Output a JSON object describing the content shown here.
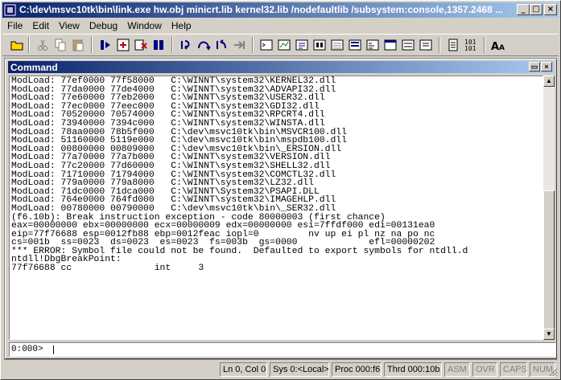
{
  "window": {
    "title": "C:\\dev\\msvc10tk\\bin\\link.exe hw.obj minicrt.lib kernel32.lib /nodefaultlib /subsystem:console,1357.2468 ..."
  },
  "menu": [
    "File",
    "Edit",
    "View",
    "Debug",
    "Window",
    "Help"
  ],
  "command_window": {
    "title": "Command",
    "output_lines": [
      "ModLoad: 77ef0000 77f58000   C:\\WINNT\\system32\\KERNEL32.dll",
      "ModLoad: 77da0000 77de4000   C:\\WINNT\\system32\\ADVAPI32.dll",
      "ModLoad: 77e60000 77eb2000   C:\\WINNT\\system32\\USER32.dll",
      "ModLoad: 77ec0000 77eec000   C:\\WINNT\\system32\\GDI32.dll",
      "ModLoad: 70520000 70574000   C:\\WINNT\\system32\\RPCRT4.dll",
      "ModLoad: 73940000 7394c000   C:\\WINNT\\system32\\WINSTA.dll",
      "ModLoad: 78aa0000 78b5f000   C:\\dev\\msvc10tk\\bin\\MSVCR100.dll",
      "ModLoad: 51160000 5119e000   C:\\dev\\msvc10tk\\bin\\mspdb100.dll",
      "ModLoad: 00800000 00809000   C:\\dev\\msvc10tk\\bin\\_ERSION.dll",
      "ModLoad: 77a70000 77a7b000   C:\\WINNT\\system32\\VERSION.dll",
      "ModLoad: 77c20000 77d60000   C:\\WINNT\\system32\\SHELL32.dll",
      "ModLoad: 71710000 71794000   C:\\WINNT\\system32\\COMCTL32.dll",
      "ModLoad: 779a0000 779a8000   C:\\WINNT\\system32\\LZ32.dll",
      "ModLoad: 71dc0000 71dca000   C:\\WINNT\\System32\\PSAPI.DLL",
      "ModLoad: 764e0000 764fd000   C:\\WINNT\\system32\\IMAGEHLP.dll",
      "ModLoad: 00780000 00790000   C:\\dev\\msvc10tk\\bin\\_SER32.dll",
      "(f6.10b): Break instruction exception - code 80000003 (first chance)",
      "eax=00000000 ebx=00000000 ecx=00000009 edx=00000000 esi=7ffdf000 edi=00131ea0",
      "eip=77f76688 esp=0012fb88 ebp=0012feac iopl=0         nv up ei pl nz na po nc",
      "cs=001b  ss=0023  ds=0023  es=0023  fs=003b  gs=0000             efl=00000202",
      "*** ERROR: Symbol file could not be found.  Defaulted to export symbols for ntdll.d",
      "ntdll!DbgBreakPoint:",
      "77f76688 cc               int     3"
    ],
    "prompt": "0:000>",
    "input_value": ""
  },
  "status": {
    "position": "Ln 0, Col 0",
    "sys": "Sys 0:<Local>",
    "proc": "Proc 000:f6",
    "thrd": "Thrd 000:10b",
    "asm": "ASM",
    "ovr": "OVR",
    "caps": "CAPS",
    "num": "NUM"
  }
}
